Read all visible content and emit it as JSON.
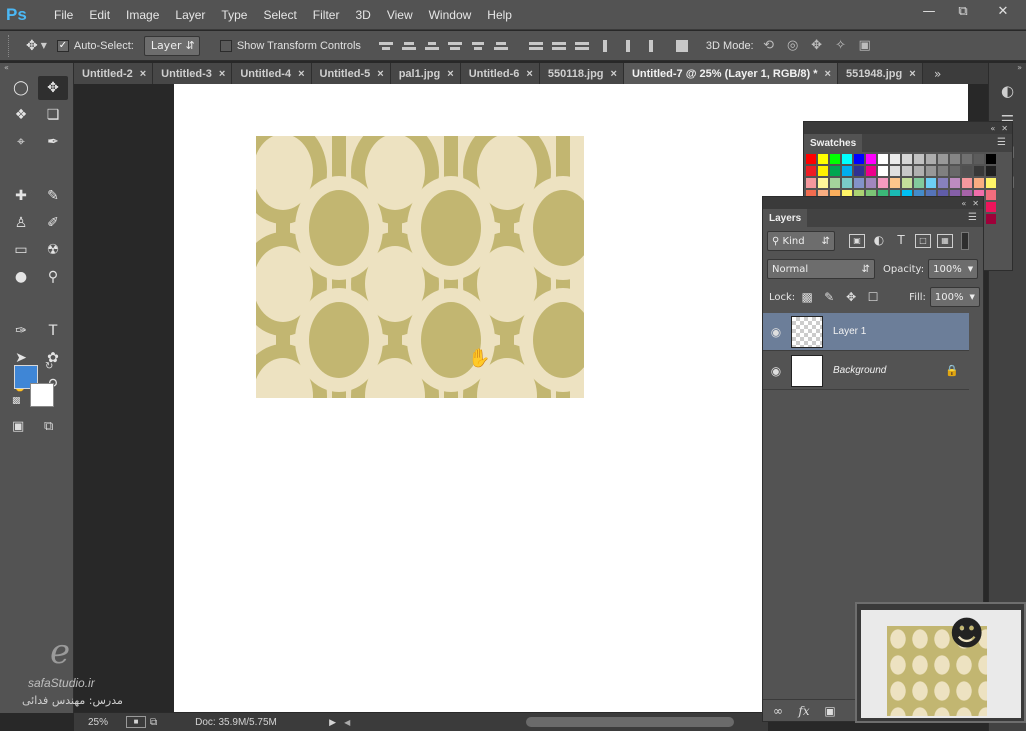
{
  "app": {
    "logo": "Ps"
  },
  "menu": [
    "File",
    "Edit",
    "Image",
    "Layer",
    "Type",
    "Select",
    "Filter",
    "3D",
    "View",
    "Window",
    "Help"
  ],
  "options": {
    "auto_select_label": "Auto-Select:",
    "auto_select_value": "Layer",
    "show_transform_label": "Show Transform Controls",
    "mode3d_label": "3D Mode:"
  },
  "tabs": [
    {
      "label": "Untitled-2"
    },
    {
      "label": "Untitled-3"
    },
    {
      "label": "Untitled-4"
    },
    {
      "label": "Untitled-5"
    },
    {
      "label": "pal1.jpg"
    },
    {
      "label": "Untitled-6"
    },
    {
      "label": "550118.jpg"
    },
    {
      "label": "Untitled-7 @ 25% (Layer 1, RGB/8) *"
    },
    {
      "label": "551948.jpg"
    }
  ],
  "colors": {
    "foreground": "#3f86d6",
    "background": "#ffffff",
    "pattern_dark": "#c2b671",
    "pattern_light": "#ede2c1"
  },
  "status": {
    "zoom": "25%",
    "doc": "Doc: 35.9M/5.75M"
  },
  "watermark": {
    "site": "safaStudio.ir",
    "teacher": "مدرس: مهندس فدائی"
  },
  "swatches": {
    "title": "Swatches"
  },
  "layers": {
    "title": "Layers",
    "kind_label": "Kind",
    "blend_mode": "Normal",
    "opacity_label": "Opacity:",
    "opacity_value": "100%",
    "lock_label": "Lock:",
    "fill_label": "Fill:",
    "fill_value": "100%",
    "items": [
      {
        "name": "Layer 1"
      },
      {
        "name": "Background"
      }
    ]
  }
}
